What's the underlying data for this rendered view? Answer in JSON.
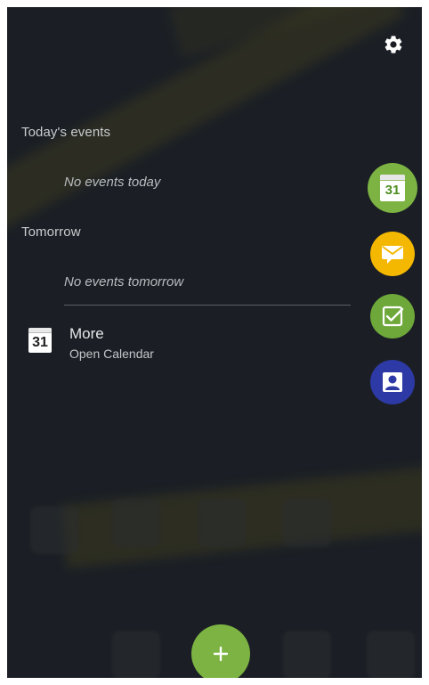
{
  "panel": {
    "today_heading": "Today's events",
    "today_empty": "No events today",
    "tomorrow_heading": "Tomorrow",
    "tomorrow_empty": "No events tomorrow",
    "more_title": "More",
    "more_subtitle": "Open Calendar",
    "calendar_icon_number": "31"
  },
  "side_tabs": [
    {
      "name": "calendar",
      "icon": "calendar-icon",
      "color": "#7cb342",
      "label": "31",
      "selected": true
    },
    {
      "name": "email",
      "icon": "email-icon",
      "color": "#f5b800"
    },
    {
      "name": "tasks",
      "icon": "tasks-icon",
      "color": "#6ea83a"
    },
    {
      "name": "contacts",
      "icon": "contact-icon",
      "color": "#2d3aa5"
    }
  ],
  "actions": {
    "settings_icon": "gear-icon",
    "add_icon": "plus-icon",
    "add_color": "#7cb342"
  }
}
